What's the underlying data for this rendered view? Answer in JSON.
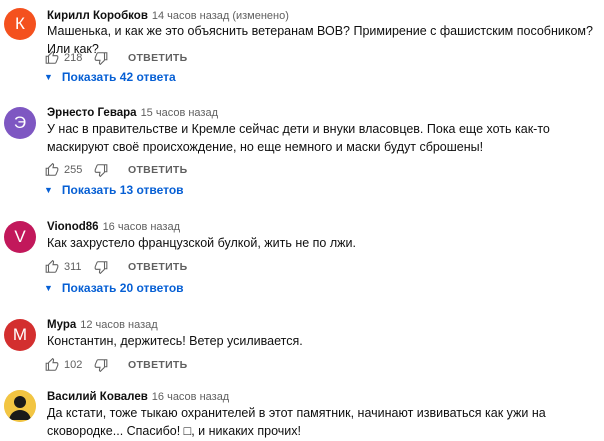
{
  "comments": [
    {
      "author": "Кирилл Коробков",
      "time": "14 часов назад",
      "edited": "(изменено)",
      "avatar_letter": "К",
      "avatar_color": "#f4511e",
      "text": "Машенька, и как же это объяснить ветеранам ВОВ? Примирение с фашистским пособником? Или как?",
      "likes": "218",
      "reply_label": "ОТВЕТИТЬ",
      "replies_label": "Показать 42 ответа"
    },
    {
      "author": "Эрнесто Гевара",
      "time": "15 часов назад",
      "avatar_letter": "Э",
      "avatar_color": "#7e57c2",
      "text": "У нас в правительстве и Кремле сейчас дети и внуки власовцев. Пока еще хоть как-то маскируют своё происхождение, но еще немного и маски будут сброшены!",
      "likes": "255",
      "reply_label": "ОТВЕТИТЬ",
      "replies_label": "Показать 13 ответов"
    },
    {
      "author": "Vionod86",
      "time": "16 часов назад",
      "avatar_letter": "V",
      "avatar_color": "#c2185b",
      "text": "Как захрустело французской булкой, жить не по лжи.",
      "likes": "311",
      "reply_label": "ОТВЕТИТЬ",
      "replies_label": "Показать 20 ответов"
    },
    {
      "author": "Мура",
      "time": "12 часов назад",
      "avatar_letter": "М",
      "avatar_color": "#d32f2f",
      "text": "Константин, держитесь! Ветер усиливается.",
      "likes": "102",
      "reply_label": "ОТВЕТИТЬ"
    },
    {
      "author": "Василий Ковалев",
      "time": "16 часов назад",
      "avatar_icon": "silhouette-photo-icon",
      "text": "Да кстати, тоже тыкаю охранителей в этот памятник, начинают извиваться как ужи на сковородке... Спасибо! □, и никаких прочих!"
    }
  ],
  "colors": {
    "link_blue": "#065fd4",
    "meta_gray": "#606060"
  },
  "icons": {
    "like": "thumb-up-icon",
    "dislike": "thumb-down-icon",
    "expand": "caret-down-icon"
  }
}
